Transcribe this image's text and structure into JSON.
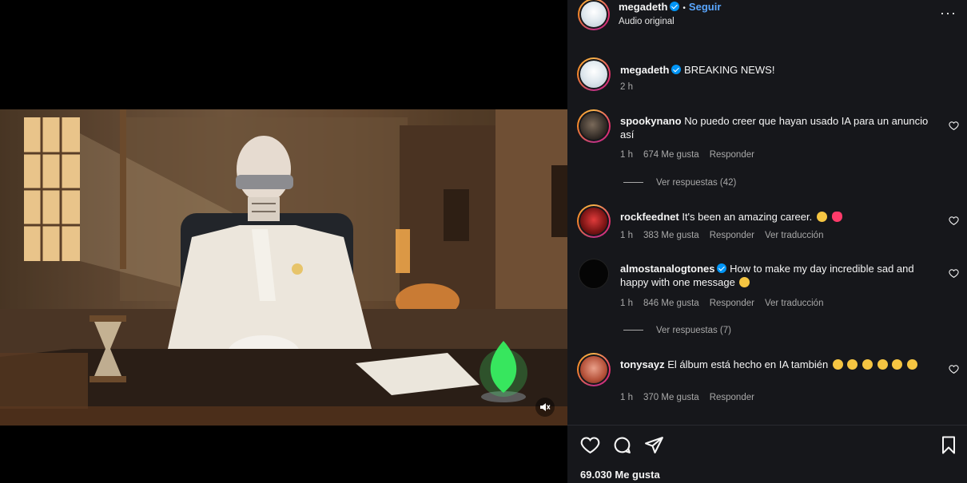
{
  "post": {
    "username": "megadeth",
    "follow_label": "Seguir",
    "audio_label": "Audio original",
    "more_label": "···"
  },
  "caption": {
    "username": "megadeth",
    "text": "BREAKING NEWS!",
    "time": "2 h"
  },
  "comments": [
    {
      "username": "spookynano",
      "text": "No puedo creer que hayan usado IA para un anuncio así",
      "time": "1 h",
      "likes": "674 Me gusta",
      "reply": "Responder",
      "view_replies": "Ver respuestas (42)"
    },
    {
      "username": "rockfeednet",
      "text": "It's been an amazing career.",
      "time": "1 h",
      "likes": "383 Me gusta",
      "reply": "Responder",
      "translate": "Ver traducción"
    },
    {
      "username": "almostanalogtones",
      "text": "How to make my day incredible sad and happy with one message",
      "time": "1 h",
      "likes": "846 Me gusta",
      "reply": "Responder",
      "translate": "Ver traducción",
      "view_replies": "Ver respuestas (7)"
    },
    {
      "username": "tonysayz",
      "text": "El álbum está hecho en IA también",
      "time": "1 h",
      "likes": "370 Me gusta",
      "reply": "Responder"
    }
  ],
  "footer": {
    "likes": "69.030 Me gusta"
  },
  "colors": {
    "panel_bg": "#16171b",
    "link_blue": "#5aa7ff",
    "verified_blue": "#0095f6",
    "muted_text": "#a8a8a8"
  },
  "icons": [
    "verified-badge-icon",
    "more-options-icon",
    "heart-icon",
    "comment-icon",
    "share-icon",
    "bookmark-icon",
    "mute-icon",
    "laugh-emoji-icon",
    "clap-emoji-icon",
    "heart-emoji-icon",
    "sad-emoji-icon"
  ]
}
